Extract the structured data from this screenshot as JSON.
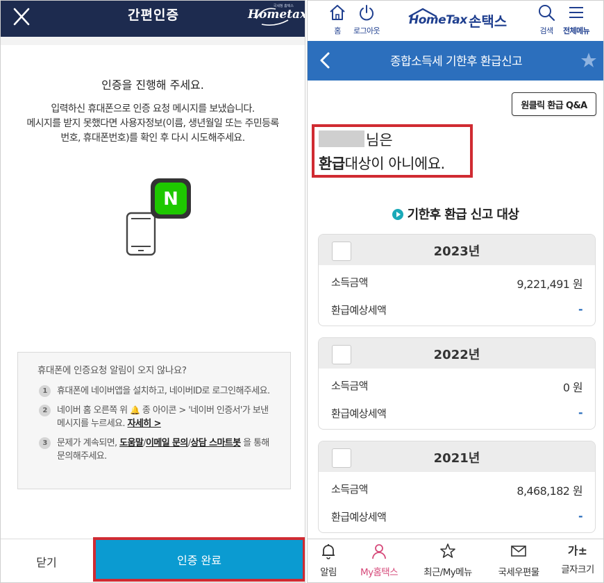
{
  "left": {
    "header": {
      "title": "간편인증",
      "logo_text": "Hometax.",
      "logo_sub": "국세청 홈택스"
    },
    "message_title": "인증을 진행해 주세요.",
    "message_lines": [
      "입력하신 휴대폰으로 인증 요청 메시지를 보냈습니다.",
      "메시지를 받지 못했다면 사용자정보(이름, 생년월일 또는 주민등록",
      "번호, 휴대폰번호)를 확인 후 다시 시도해주세요."
    ],
    "naver_badge": "N",
    "help": {
      "title": "휴대폰에 인증요청 알림이 오지 않나요?",
      "items": [
        {
          "num": "1",
          "text": "휴대폰에 네이버앱을 설치하고, 네이버ID로 로그인해주세요."
        },
        {
          "num": "2",
          "text_before": "네이버 홈 오른쪽 위",
          "text_mid": "종 아이콘 > '네이버 인증서'가 보낸 메시지를 누르세요.",
          "link": "자세히 >"
        },
        {
          "num": "3",
          "text_before": "문제가 계속되면,",
          "link_help": "도움말",
          "sep1": "/",
          "link_email": "이메일 문의",
          "sep2": "/",
          "link_chatbot": "상담 스마트봇",
          "text_after": "을 통해 문의해주세요."
        }
      ]
    },
    "footer": {
      "close_label": "닫기",
      "confirm_label": "인증 완료"
    }
  },
  "right": {
    "top": {
      "home_label": "홈",
      "logout_label": "로그아웃",
      "brand_en": "HomeTax",
      "brand_ko": "손택스",
      "search_label": "검색",
      "menu_label": "전체메뉴"
    },
    "nav": {
      "title": "종합소득세 기한후 환급신고"
    },
    "qa_button": "원클릭 환급 Q&A",
    "notice": {
      "suffix": "님은",
      "line2_bold": "환급",
      "line2_rest": "대상이 아니에요."
    },
    "section_title": "기한후 환급 신고 대상",
    "years": [
      {
        "year": "2023년",
        "income_label": "소득금액",
        "income_value": "9,221,491 원",
        "refund_label": "환급예상세액",
        "refund_value": "-"
      },
      {
        "year": "2022년",
        "income_label": "소득금액",
        "income_value": "0 원",
        "refund_label": "환급예상세액",
        "refund_value": "-"
      },
      {
        "year": "2021년",
        "income_label": "소득금액",
        "income_value": "8,468,182 원",
        "refund_label": "환급예상세액",
        "refund_value": "-"
      }
    ],
    "tabs": {
      "alerts": "알림",
      "my_hometax": "My홈택스",
      "recent": "최근/My메뉴",
      "mail": "국세우편물",
      "font_size": "글자크기",
      "font_size_icon": "가±"
    }
  },
  "colors": {
    "left_header": "#1d2b4f",
    "confirm_button": "#0b9bd1",
    "highlight_border": "#d02b32",
    "right_nav": "#2c6fbd",
    "brand_blue": "#1f3f8f",
    "naver_green": "#1ec800",
    "active_tab": "#d64a7a"
  }
}
